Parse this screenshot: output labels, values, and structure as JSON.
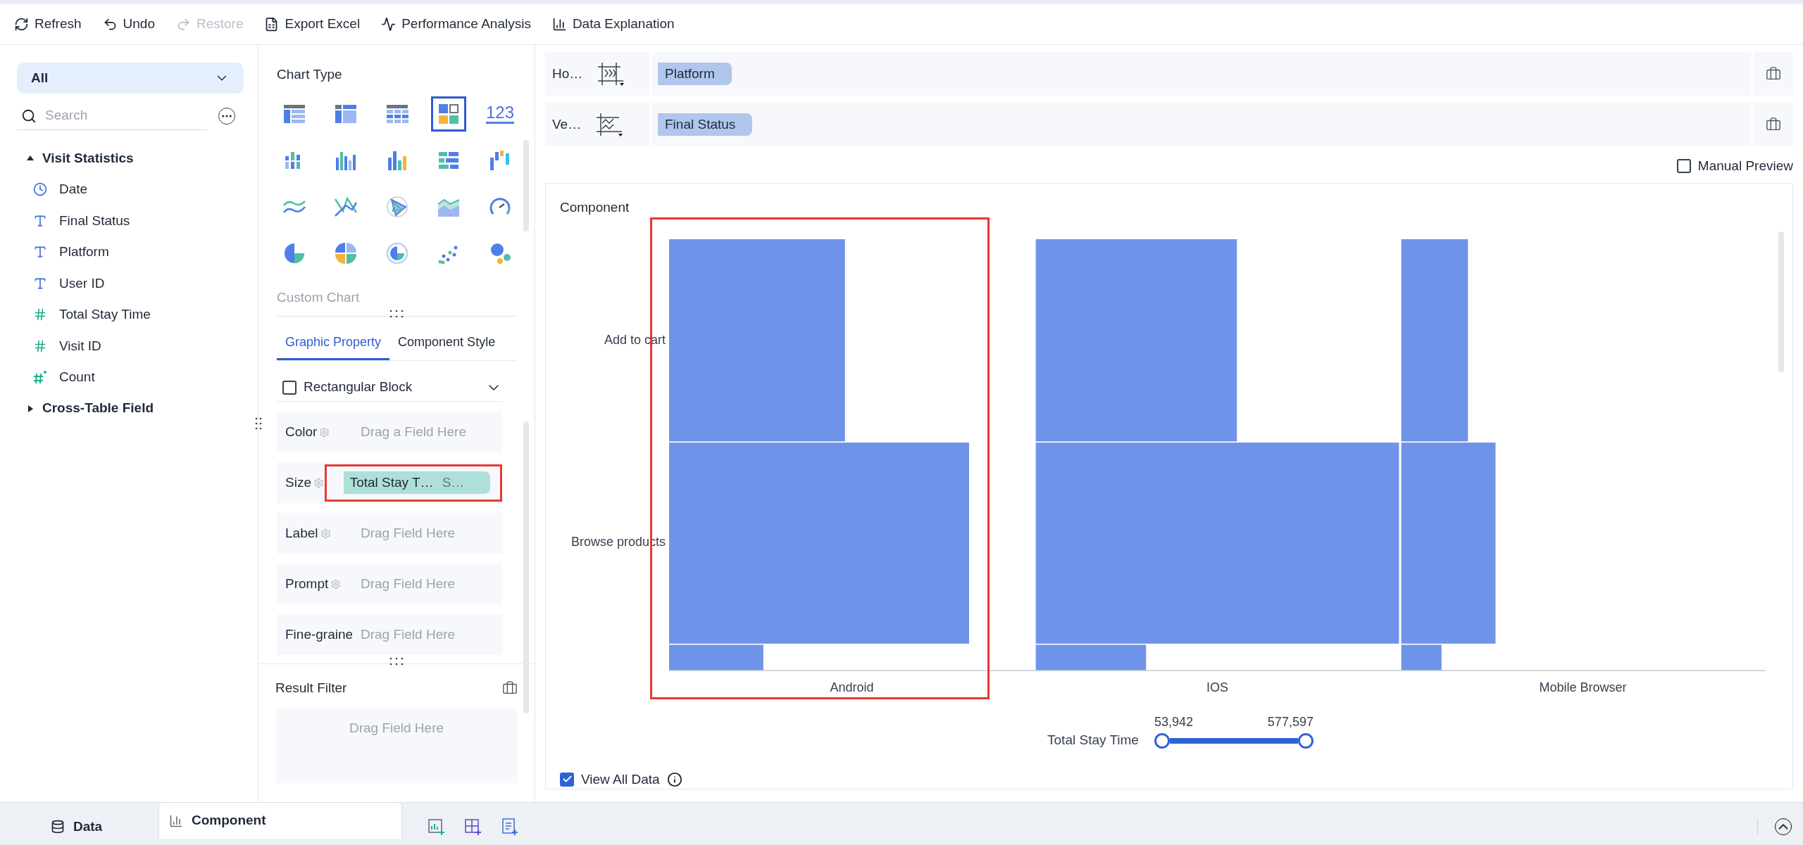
{
  "toolbar": [
    {
      "label": "Refresh",
      "kind": "refresh",
      "disabled": false
    },
    {
      "label": "Undo",
      "kind": "undo",
      "disabled": false
    },
    {
      "label": "Restore",
      "kind": "redo",
      "disabled": true
    },
    {
      "label": "Export Excel",
      "kind": "excel",
      "disabled": false
    },
    {
      "label": "Performance Analysis",
      "kind": "performance",
      "disabled": false
    },
    {
      "label": "Data Explanation",
      "kind": "explain",
      "disabled": false
    }
  ],
  "sidebar": {
    "dropdown": "All",
    "search": {
      "placeholder": "Search"
    },
    "groups": [
      {
        "label": "Visit Statistics",
        "expanded": true,
        "children": [
          {
            "label": "Date",
            "kind": "date"
          },
          {
            "label": "Final Status",
            "kind": "text"
          },
          {
            "label": "Platform",
            "kind": "text"
          },
          {
            "label": "User ID",
            "kind": "text"
          },
          {
            "label": "Total Stay Time",
            "kind": "number"
          },
          {
            "label": "Visit ID",
            "kind": "number"
          },
          {
            "label": "Count",
            "kind": "count"
          }
        ]
      },
      {
        "label": "Cross-Table Field",
        "expanded": false
      }
    ]
  },
  "chart_type": {
    "title": "Chart Type",
    "types": [
      {
        "selected": false
      },
      {
        "selected": false
      },
      {
        "selected": false
      },
      {
        "selected": true
      },
      {
        "selected": false,
        "label": "123"
      },
      {
        "selected": false
      },
      {
        "selected": false
      },
      {
        "selected": false
      },
      {
        "selected": false
      },
      {
        "selected": false
      },
      {
        "selected": false
      },
      {
        "selected": false
      },
      {
        "selected": false
      },
      {
        "selected": false
      },
      {
        "selected": false
      },
      {
        "selected": false
      },
      {
        "selected": false
      },
      {
        "selected": false
      },
      {
        "selected": false
      },
      {
        "selected": false
      }
    ],
    "custom_chart": "Custom Chart"
  },
  "property_tabs": [
    {
      "label": "Graphic Property",
      "selected": true
    },
    {
      "label": "Component Style",
      "selected": false
    }
  ],
  "block": {
    "label": "Rectangular Block",
    "checked": false
  },
  "properties": [
    {
      "label": "Color",
      "gear": true,
      "placeholder": "Drag a Field Here"
    },
    {
      "label": "Size",
      "gear": true,
      "chip": "Total Stay T…",
      "chip_suffix": "S…"
    },
    {
      "label": "Label",
      "gear": true,
      "placeholder": "Drag Field Here"
    },
    {
      "label": "Prompt",
      "gear": true,
      "placeholder": "Drag Field Here"
    },
    {
      "label": "Fine-graine",
      "gear": false,
      "placeholder": "Drag Field Here"
    }
  ],
  "result_filter": {
    "title": "Result Filter",
    "placeholder": "Drag Field Here"
  },
  "axes": [
    {
      "label": "Ho…",
      "kind": "horizontal",
      "field": "Platform"
    },
    {
      "label": "Ve…",
      "kind": "vertical",
      "field": "Final Status"
    }
  ],
  "manual_preview": {
    "label": "Manual Preview",
    "checked": false
  },
  "component": {
    "title": "Component",
    "row_labels": [
      "Add to cart",
      "Browse products"
    ],
    "column_labels": [
      "Android",
      "IOS",
      "Mobile Browser"
    ],
    "slider": {
      "label": "Total Stay Time",
      "min_reading": "53,942",
      "max_reading": "577,597",
      "level": 1
    },
    "view_all": {
      "label": "View All Data",
      "checked": true
    }
  },
  "bottom_tabs": [
    {
      "label": "Data",
      "kind": "data",
      "selected": false
    },
    {
      "label": "Component",
      "kind": "component",
      "selected": true
    }
  ]
}
